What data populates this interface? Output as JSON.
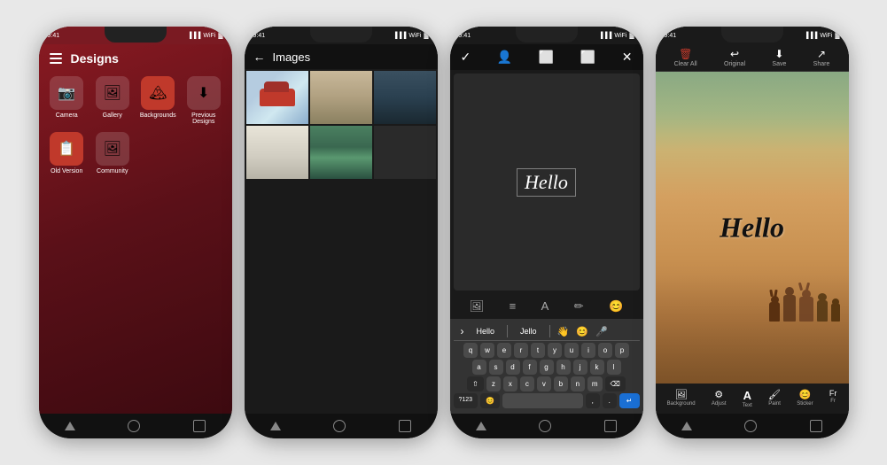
{
  "phones": [
    {
      "id": "phone1",
      "title": "Designs",
      "items": [
        {
          "label": "Camera",
          "icon": "📷"
        },
        {
          "label": "Gallery",
          "icon": "🖼"
        },
        {
          "label": "Backgrounds",
          "icon": "🏔"
        },
        {
          "label": "Previous Designs",
          "icon": "⬇"
        },
        {
          "label": "Old Version",
          "icon": "📋"
        },
        {
          "label": "Community",
          "icon": "🖼"
        }
      ]
    },
    {
      "id": "phone2",
      "title": "Images",
      "back_label": "←"
    },
    {
      "id": "phone3",
      "header_icons": [
        "✓",
        "👤",
        "⬜",
        "⬜",
        "✕"
      ],
      "canvas_text": "Hello",
      "suggestions": [
        "Hello",
        "Jello",
        "👋",
        "😊",
        "🎤"
      ],
      "keyboard_rows": [
        [
          "q",
          "w",
          "e",
          "r",
          "t",
          "y",
          "u",
          "i",
          "o",
          "p"
        ],
        [
          "a",
          "s",
          "d",
          "f",
          "g",
          "h",
          "j",
          "k",
          "l"
        ],
        [
          "⇧",
          "z",
          "x",
          "c",
          "v",
          "b",
          "n",
          "m",
          "⌫"
        ],
        [
          "?123",
          "😊",
          "",
          "",
          "",
          "",
          ",",
          ".",
          "↵"
        ]
      ]
    },
    {
      "id": "phone4",
      "header_items": [
        {
          "icon": "🗑",
          "label": "Clear All",
          "color": "red"
        },
        {
          "icon": "↩",
          "label": "Original",
          "color": "white"
        },
        {
          "icon": "⬇",
          "label": "Save",
          "color": "white"
        },
        {
          "icon": "↗",
          "label": "Share",
          "color": "white"
        }
      ],
      "canvas_text": "Hello",
      "tools": [
        {
          "icon": "🖼",
          "label": "Background"
        },
        {
          "icon": "⚙",
          "label": "Adjust"
        },
        {
          "icon": "A",
          "label": "Text"
        },
        {
          "icon": "🖌",
          "label": "Paint"
        },
        {
          "icon": "😊",
          "label": "Sticker"
        },
        {
          "icon": "Fr",
          "label": "Fr"
        }
      ]
    }
  ]
}
